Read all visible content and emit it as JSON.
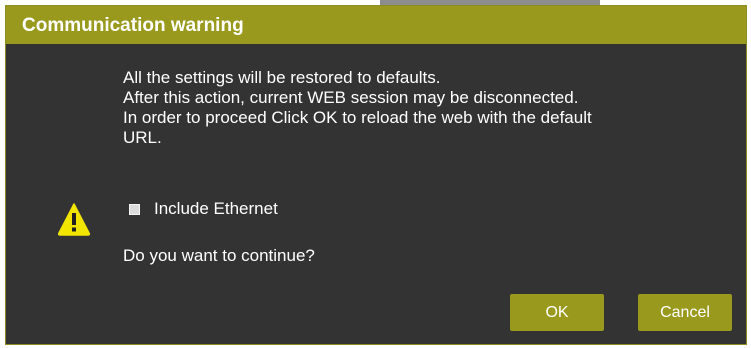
{
  "dialog": {
    "title": "Communication warning",
    "message_lines": [
      "All the settings will be restored to defaults.",
      "After this action, current WEB session may be disconnected.",
      "In order to proceed Click OK to reload the web with the default",
      "URL."
    ],
    "checkbox": {
      "label": "Include Ethernet",
      "checked": false
    },
    "question": "Do you want to continue?",
    "buttons": {
      "ok_label": "OK",
      "cancel_label": "Cancel"
    },
    "icon": "warning-triangle-icon"
  },
  "colors": {
    "title_bar": "#999a1d",
    "dialog_bg": "#333333",
    "button_bg": "#999a1d",
    "warning_icon": "#f2e600",
    "text": "#ffffff"
  }
}
